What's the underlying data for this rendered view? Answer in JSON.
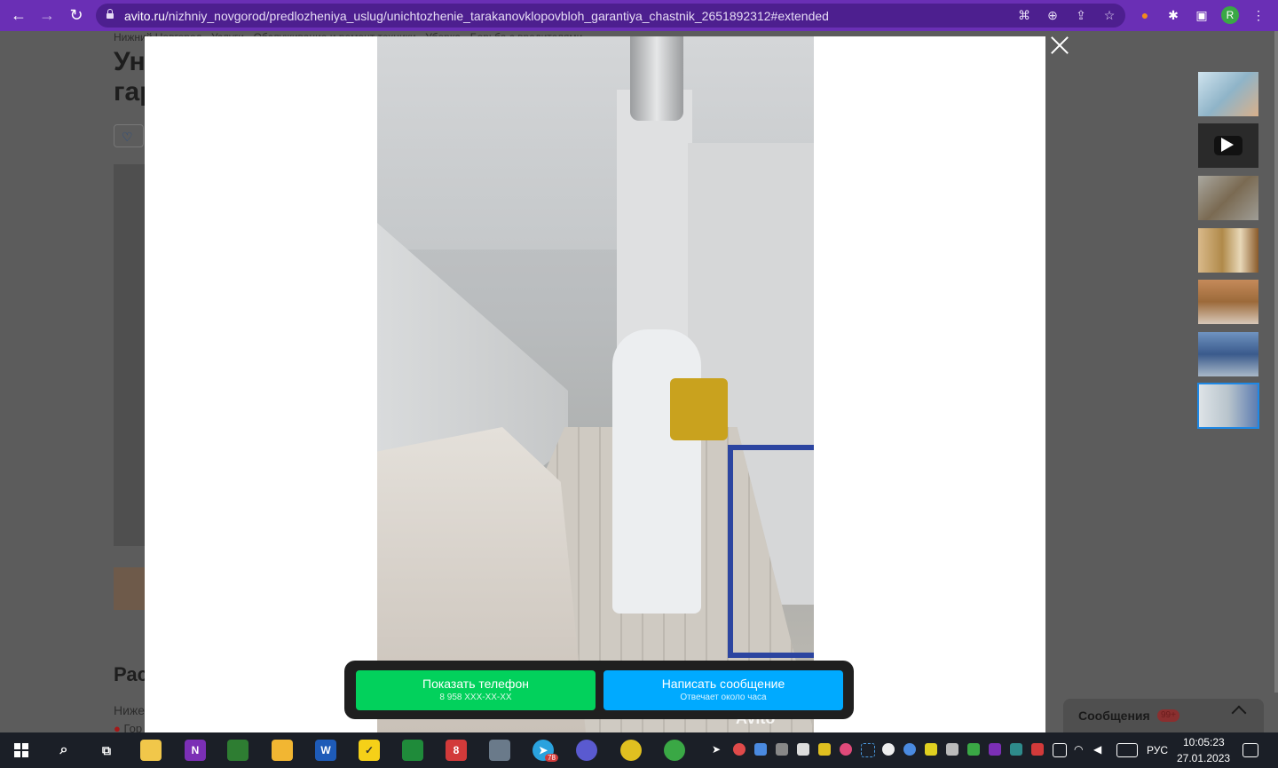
{
  "browser": {
    "url_host": "avito.ru",
    "url_path": "/nizhniy_novgorod/predlozheniya_uslug/unichtozhenie_tarakanovklopovbloh_garantiya_chastnik_2651892312#extended",
    "avatar_letter": "R"
  },
  "background_page": {
    "breadcrumb": "Нижний Новгород · Услуги · Обслуживание и ремонт техники · Уборка · Борьба с вредителями",
    "title_line1": "Ун",
    "title_line2": "гар",
    "section_heading": "Рас",
    "text_line1": "Ниже",
    "text_line2": "Гор"
  },
  "gallery": {
    "watermark": "Avito",
    "thumbnails": [
      {
        "name": "thumb-portrait",
        "color": "#8fb4c8"
      },
      {
        "name": "thumb-video",
        "color": "#2a2a2a"
      },
      {
        "name": "thumb-insects",
        "color": "#8d8a80"
      },
      {
        "name": "thumb-bottles",
        "color": "#b08a4a"
      },
      {
        "name": "thumb-hall",
        "color": "#9c6a3a"
      },
      {
        "name": "thumb-worker-blue",
        "color": "#3a5a8c"
      },
      {
        "name": "thumb-corridor",
        "color": "#b8c4cc"
      }
    ]
  },
  "cta": {
    "phone_label": "Показать телефон",
    "phone_number": "8 958 XXX-XX-XX",
    "message_label": "Написать сообщение",
    "message_sub": "Отвечает около часа"
  },
  "messages_panel": {
    "label": "Сообщения",
    "badge": "99+"
  },
  "taskbar": {
    "language": "РУС",
    "time": "10:05:23",
    "date": "27.01.2023",
    "telegram_badge": "78"
  }
}
